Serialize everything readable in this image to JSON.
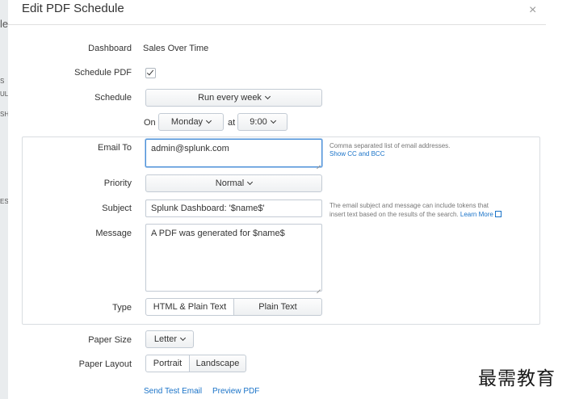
{
  "background": {
    "fragments": [
      "le",
      "S",
      "UL",
      "SH",
      "ES"
    ]
  },
  "modal": {
    "title": "Edit PDF Schedule",
    "close_glyph": "×"
  },
  "dashboard": {
    "label": "Dashboard",
    "value": "Sales Over Time"
  },
  "schedule_pdf": {
    "label": "Schedule PDF",
    "checked": true
  },
  "schedule": {
    "label": "Schedule",
    "frequency": "Run every week",
    "on_label": "On",
    "day": "Monday",
    "at_label": "at",
    "time": "9:00"
  },
  "email_to": {
    "label": "Email To",
    "value": "admin@splunk.com",
    "help": "Comma separated list of email addresses.",
    "link": "Show CC and BCC"
  },
  "priority": {
    "label": "Priority",
    "value": "Normal"
  },
  "subject": {
    "label": "Subject",
    "value": "Splunk Dashboard: '$name$'",
    "help_line1": "The email subject and message can include tokens that",
    "help_line2": "insert text based on the results of the search.",
    "help_link": "Learn More"
  },
  "message": {
    "label": "Message",
    "value": "A PDF was generated for $name$"
  },
  "type": {
    "label": "Type",
    "options": [
      "HTML & Plain Text",
      "Plain Text"
    ],
    "selected": 0
  },
  "paper_size": {
    "label": "Paper Size",
    "value": "Letter"
  },
  "paper_layout": {
    "label": "Paper Layout",
    "options": [
      "Portrait",
      "Landscape"
    ],
    "selected": 0
  },
  "footer": {
    "send_test": "Send Test Email",
    "preview": "Preview PDF"
  },
  "watermark": "最需教育"
}
